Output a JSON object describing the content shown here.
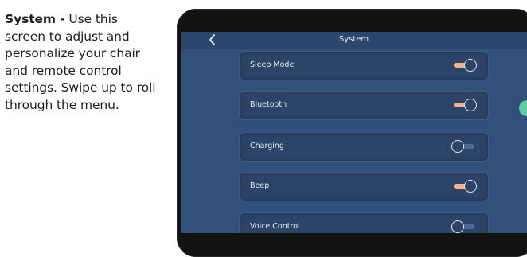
{
  "caption": {
    "bold": "System -",
    "text": " Use this screen to adjust and personalize your chair and remote control settings. Swipe up to roll through the menu."
  },
  "screen": {
    "title": "System",
    "back_icon": "chevron-left-icon"
  },
  "settings": [
    {
      "label": "Sleep Mode",
      "on": true
    },
    {
      "label": "Bluetooth",
      "on": true
    },
    {
      "label": "Charging",
      "on": false
    },
    {
      "label": "Beep",
      "on": true
    },
    {
      "label": "Voice Control",
      "on": false
    }
  ],
  "colors": {
    "screen_bg": "#33507a",
    "row_bg": "#2b4468",
    "toggle_on": "#f2b188",
    "toggle_off": "#4b6a96",
    "side_tab": "#5fcca7"
  }
}
